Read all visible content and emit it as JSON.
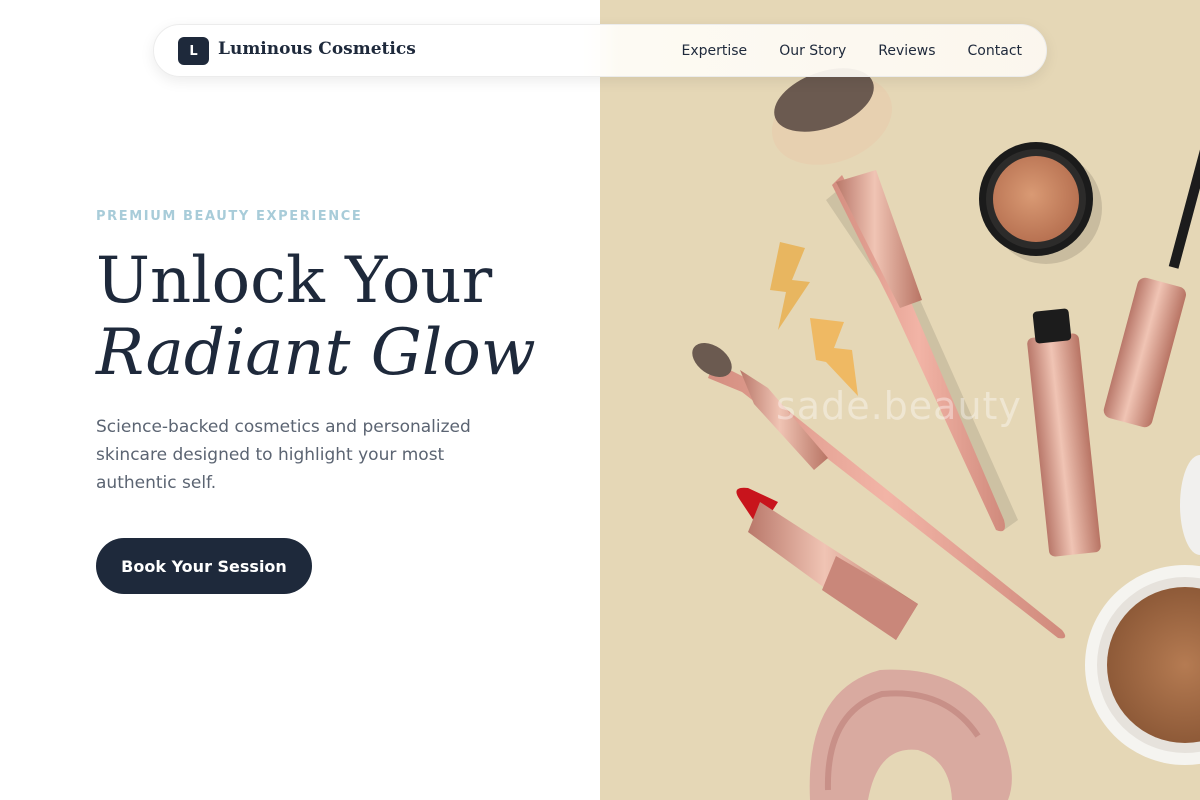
{
  "brand": {
    "logo_letter": "L",
    "name": "Luminous Cosmetics"
  },
  "nav": {
    "links": [
      "Expertise",
      "Our Story",
      "Reviews",
      "Contact"
    ]
  },
  "hero": {
    "eyebrow": "PREMIUM BEAUTY EXPERIENCE",
    "headline_line1": "Unlock Your",
    "headline_line2": "Radiant Glow",
    "subtext": "Science-backed cosmetics and personalized skincare designed to highlight your most authentic self.",
    "cta_label": "Book Your Session"
  },
  "image": {
    "watermark": "sade.beauty"
  },
  "colors": {
    "primary": "#1e293b",
    "eyebrow": "#a8ccd9",
    "body_text": "#5b6472",
    "image_background": "#e5d7b6",
    "rose_gold": "#d9a08f",
    "lipstick": "#c8141c"
  }
}
